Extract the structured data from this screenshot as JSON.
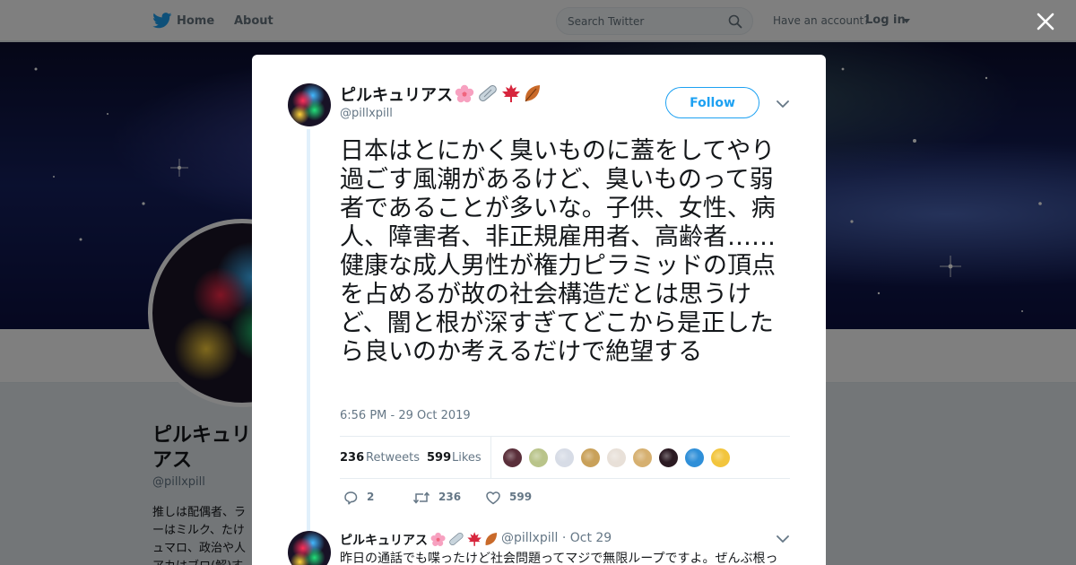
{
  "topnav": {
    "home_label": "Home",
    "about_label": "About",
    "search_placeholder": "Search Twitter",
    "have_account": "Have an account?",
    "login_label": "Log in"
  },
  "profile_bg": {
    "name": "ピルキュリアス",
    "handle": "@pillxpill",
    "bio": "推しは配偶者、ラーはミルク、たけュマロ、政治や人アカはブロ(解)す"
  },
  "tweet": {
    "author_name": "ピルキュリアス",
    "author_handle": "@pillxpill",
    "follow_label": "Follow",
    "text": "日本はとにかく臭いものに蓋をしてやり過ごす風潮があるけど、臭いものって弱者であることが多いな。子供、女性、病人、障害者、非正規雇用者、高齢者……健康な成人男性が権力ピラミッドの頂点を占めるが故の社会構造だとは思うけど、闇と根が深すぎてどこから是正したら良いのか考えるだけで絶望する",
    "timestamp": "6:56 PM - 29 Oct 2019",
    "retweets_count": "236",
    "retweets_label": "Retweets",
    "likes_count": "599",
    "likes_label": "Likes",
    "reply_count": "2",
    "retweet_action_count": "236",
    "like_action_count": "599",
    "liker_colors": [
      "#5a2f3a",
      "#b9c48a",
      "#d7dce6",
      "#c9a15a",
      "#e8e0d8",
      "#d6b070",
      "#2b1a22",
      "#2f8fd8",
      "#f2c53d"
    ]
  },
  "reply": {
    "author_name": "ピルキュリアス",
    "handle_date": "@pillxpill · Oct 29",
    "text": "昨日の通話でも喋ったけど社会問題ってマジで無限ループですよ。ぜんぶ根っ"
  }
}
